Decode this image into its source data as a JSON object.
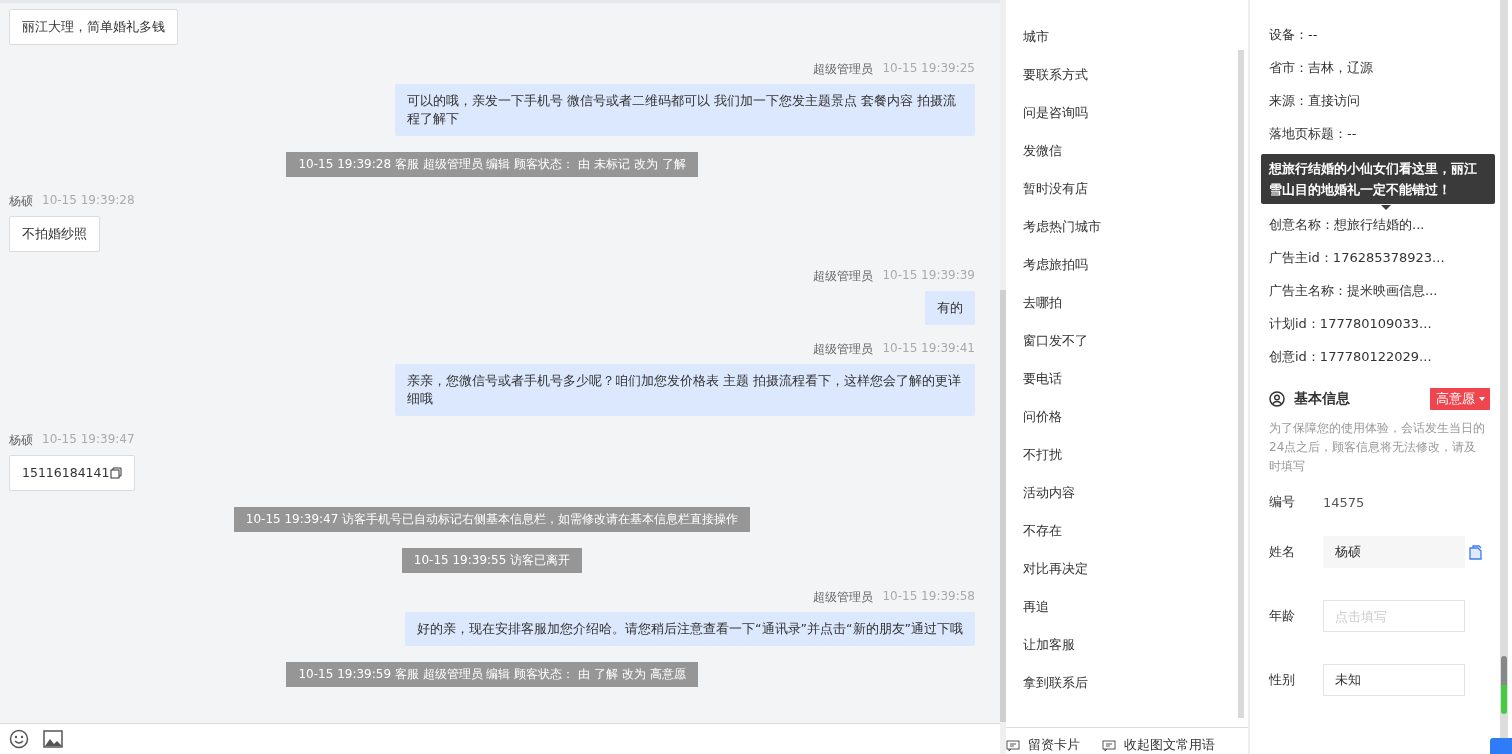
{
  "messages": [
    {
      "kind": "visitor",
      "text": "丽江大理，简单婚礼多钱"
    },
    {
      "kind": "agent",
      "name": "超级管理员",
      "time": "10-15 19:39:25",
      "text": "可以的哦，亲发一下手机号 微信号或者二维码都可以 我们加一下您发主题景点 套餐内容 拍摄流程了解下"
    },
    {
      "kind": "system",
      "text": "10-15 19:39:28 客服 超级管理员 编辑 顾客状态： 由 未标记 改为 了解"
    },
    {
      "kind": "visitor",
      "name": "杨硕",
      "time": "10-15 19:39:28",
      "text": "不拍婚纱照"
    },
    {
      "kind": "agent",
      "name": "超级管理员",
      "time": "10-15 19:39:39",
      "text": "有的"
    },
    {
      "kind": "agent",
      "name": "超级管理员",
      "time": "10-15 19:39:41",
      "text": "亲亲，您微信号或者手机号多少呢？咱们加您发价格表 主题 拍摄流程看下，这样您会了解的更详细哦"
    },
    {
      "kind": "visitor",
      "name": "杨硕",
      "time": "10-15 19:39:47",
      "text": "15116184141",
      "copyable": true
    },
    {
      "kind": "system",
      "text": "10-15 19:39:47 访客手机号已自动标记右侧基本信息栏，如需修改请在基本信息栏直接操作"
    },
    {
      "kind": "system",
      "text": "10-15 19:39:55 访客已离开"
    },
    {
      "kind": "agent",
      "name": "超级管理员",
      "time": "10-15 19:39:58",
      "text": "好的亲，现在安排客服加您介绍哈。请您稍后注意查看一下“通讯录”并点击“新的朋友”通过下哦"
    },
    {
      "kind": "system",
      "text": "10-15 19:39:59 客服 超级管理员 编辑 顾客状态： 由 了解 改为 高意愿"
    }
  ],
  "quick_replies": [
    "城市",
    "要联系方式",
    "问是咨询吗",
    "发微信",
    "暂时没有店",
    "考虑热门城市",
    "考虑旅拍吗",
    "去哪拍",
    "窗口发不了",
    "要电话",
    "问价格",
    "不打扰",
    "活动内容",
    "不存在",
    "对比再决定",
    "再追",
    "让加客服",
    "拿到联系后"
  ],
  "quick_actions": [
    "留资卡片",
    "收起图文常用语"
  ],
  "source_info": [
    "设备：--",
    "省市：吉林，辽源",
    "来源：直接访问",
    "落地页标题：--"
  ],
  "tooltip": "想旅行结婚的小仙女们看这里，丽江雪山目的地婚礼一定不能错过！",
  "source_info_more": [
    "创意名称：想旅行结婚的...",
    "广告主id：176285378923...",
    "广告主名称：提米映画信息...",
    "计划id：177780109033...",
    "创意id：177780122029..."
  ],
  "basic_info": {
    "title": "基本信息",
    "status": "高意愿",
    "note": "为了保障您的使用体验，会话发生当日的24点之后，顾客信息将无法修改，请及时填写",
    "fields": [
      {
        "kind": "text",
        "label": "编号",
        "value": "14575"
      },
      {
        "kind": "readonly",
        "label": "姓名",
        "value": "杨硕"
      },
      {
        "kind": "input",
        "label": "年龄",
        "placeholder": "点击填写"
      },
      {
        "kind": "input",
        "label": "性别",
        "value": "未知"
      }
    ]
  }
}
